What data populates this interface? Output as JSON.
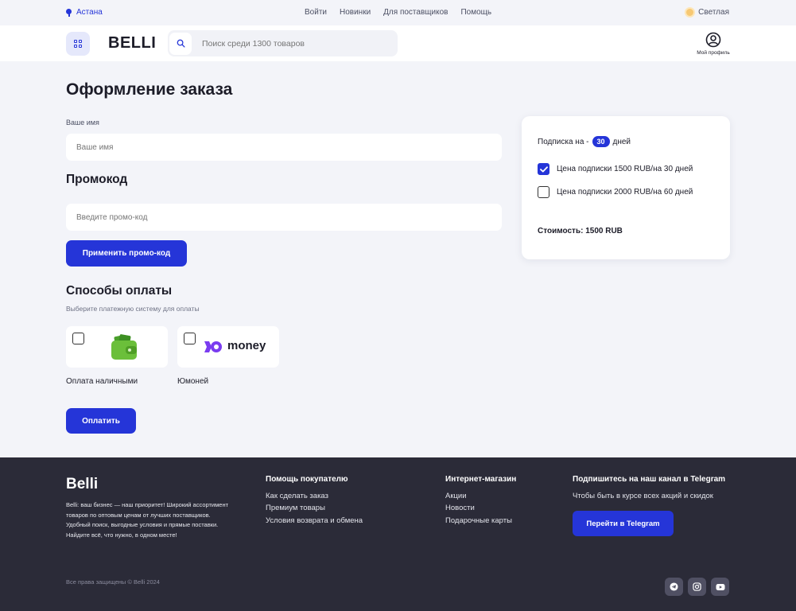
{
  "topbar": {
    "city": "Астана",
    "nav": [
      "Войти",
      "Новинки",
      "Для поставщиков",
      "Помощь"
    ],
    "theme": "Светлая"
  },
  "header": {
    "logo": "BELLI",
    "search_placeholder": "Поиск среди 1300 товаров",
    "profile_label": "Мой профиль"
  },
  "main": {
    "title": "Оформление заказа",
    "name_label": "Ваше имя",
    "name_placeholder": "Ваше имя",
    "promo_title": "Промокод",
    "promo_placeholder": "Введите промо-код",
    "promo_button": "Применить промо-код",
    "payment_title": "Способы оплаты",
    "payment_subtitle": "Выберите платежную систему для оплаты",
    "payment_methods": [
      {
        "label": "Оплата наличными",
        "icon": "wallet-icon"
      },
      {
        "label": "Юмоней",
        "icon": "yoomoney-logo",
        "brand_text": "money"
      }
    ],
    "pay_button": "Оплатить"
  },
  "summary": {
    "subscription_prefix": "Подписка на -",
    "days_value": "30",
    "days_suffix": "дней",
    "options": [
      {
        "label": "Цена подписки 1500 RUB/на 30 дней",
        "checked": true
      },
      {
        "label": "Цена подписки 2000 RUB/на 60 дней",
        "checked": false
      }
    ],
    "cost": "Стоимость: 1500 RUB"
  },
  "footer": {
    "logo": "Belli",
    "description": "Belli: ваш бизнес — наш приоритет! Широкий ассортимент товаров по оптовым ценам от лучших поставщиков. Удобный поиск, выгодные условия и прямые поставки. Найдите всё, что нужно, в одном месте!",
    "help_title": "Помощь покупателю",
    "help_links": [
      "Как сделать заказ",
      "Премиум товары",
      "Условия возврата и обмена"
    ],
    "shop_title": "Интернет-магазин",
    "shop_links": [
      "Акции",
      "Новости",
      "Подарочные карты"
    ],
    "telegram_title": "Подпишитесь на наш канал в Telegram",
    "telegram_text": "Чтобы быть в курсе всех акций и скидок",
    "telegram_button": "Перейти в Telegram",
    "copyright": "Все права защищены © Belli 2024",
    "socials": [
      "telegram-icon",
      "instagram-icon",
      "youtube-icon"
    ]
  },
  "colors": {
    "accent": "#2535d8",
    "background": "#f3f4f9",
    "footer": "#2b2b38"
  }
}
